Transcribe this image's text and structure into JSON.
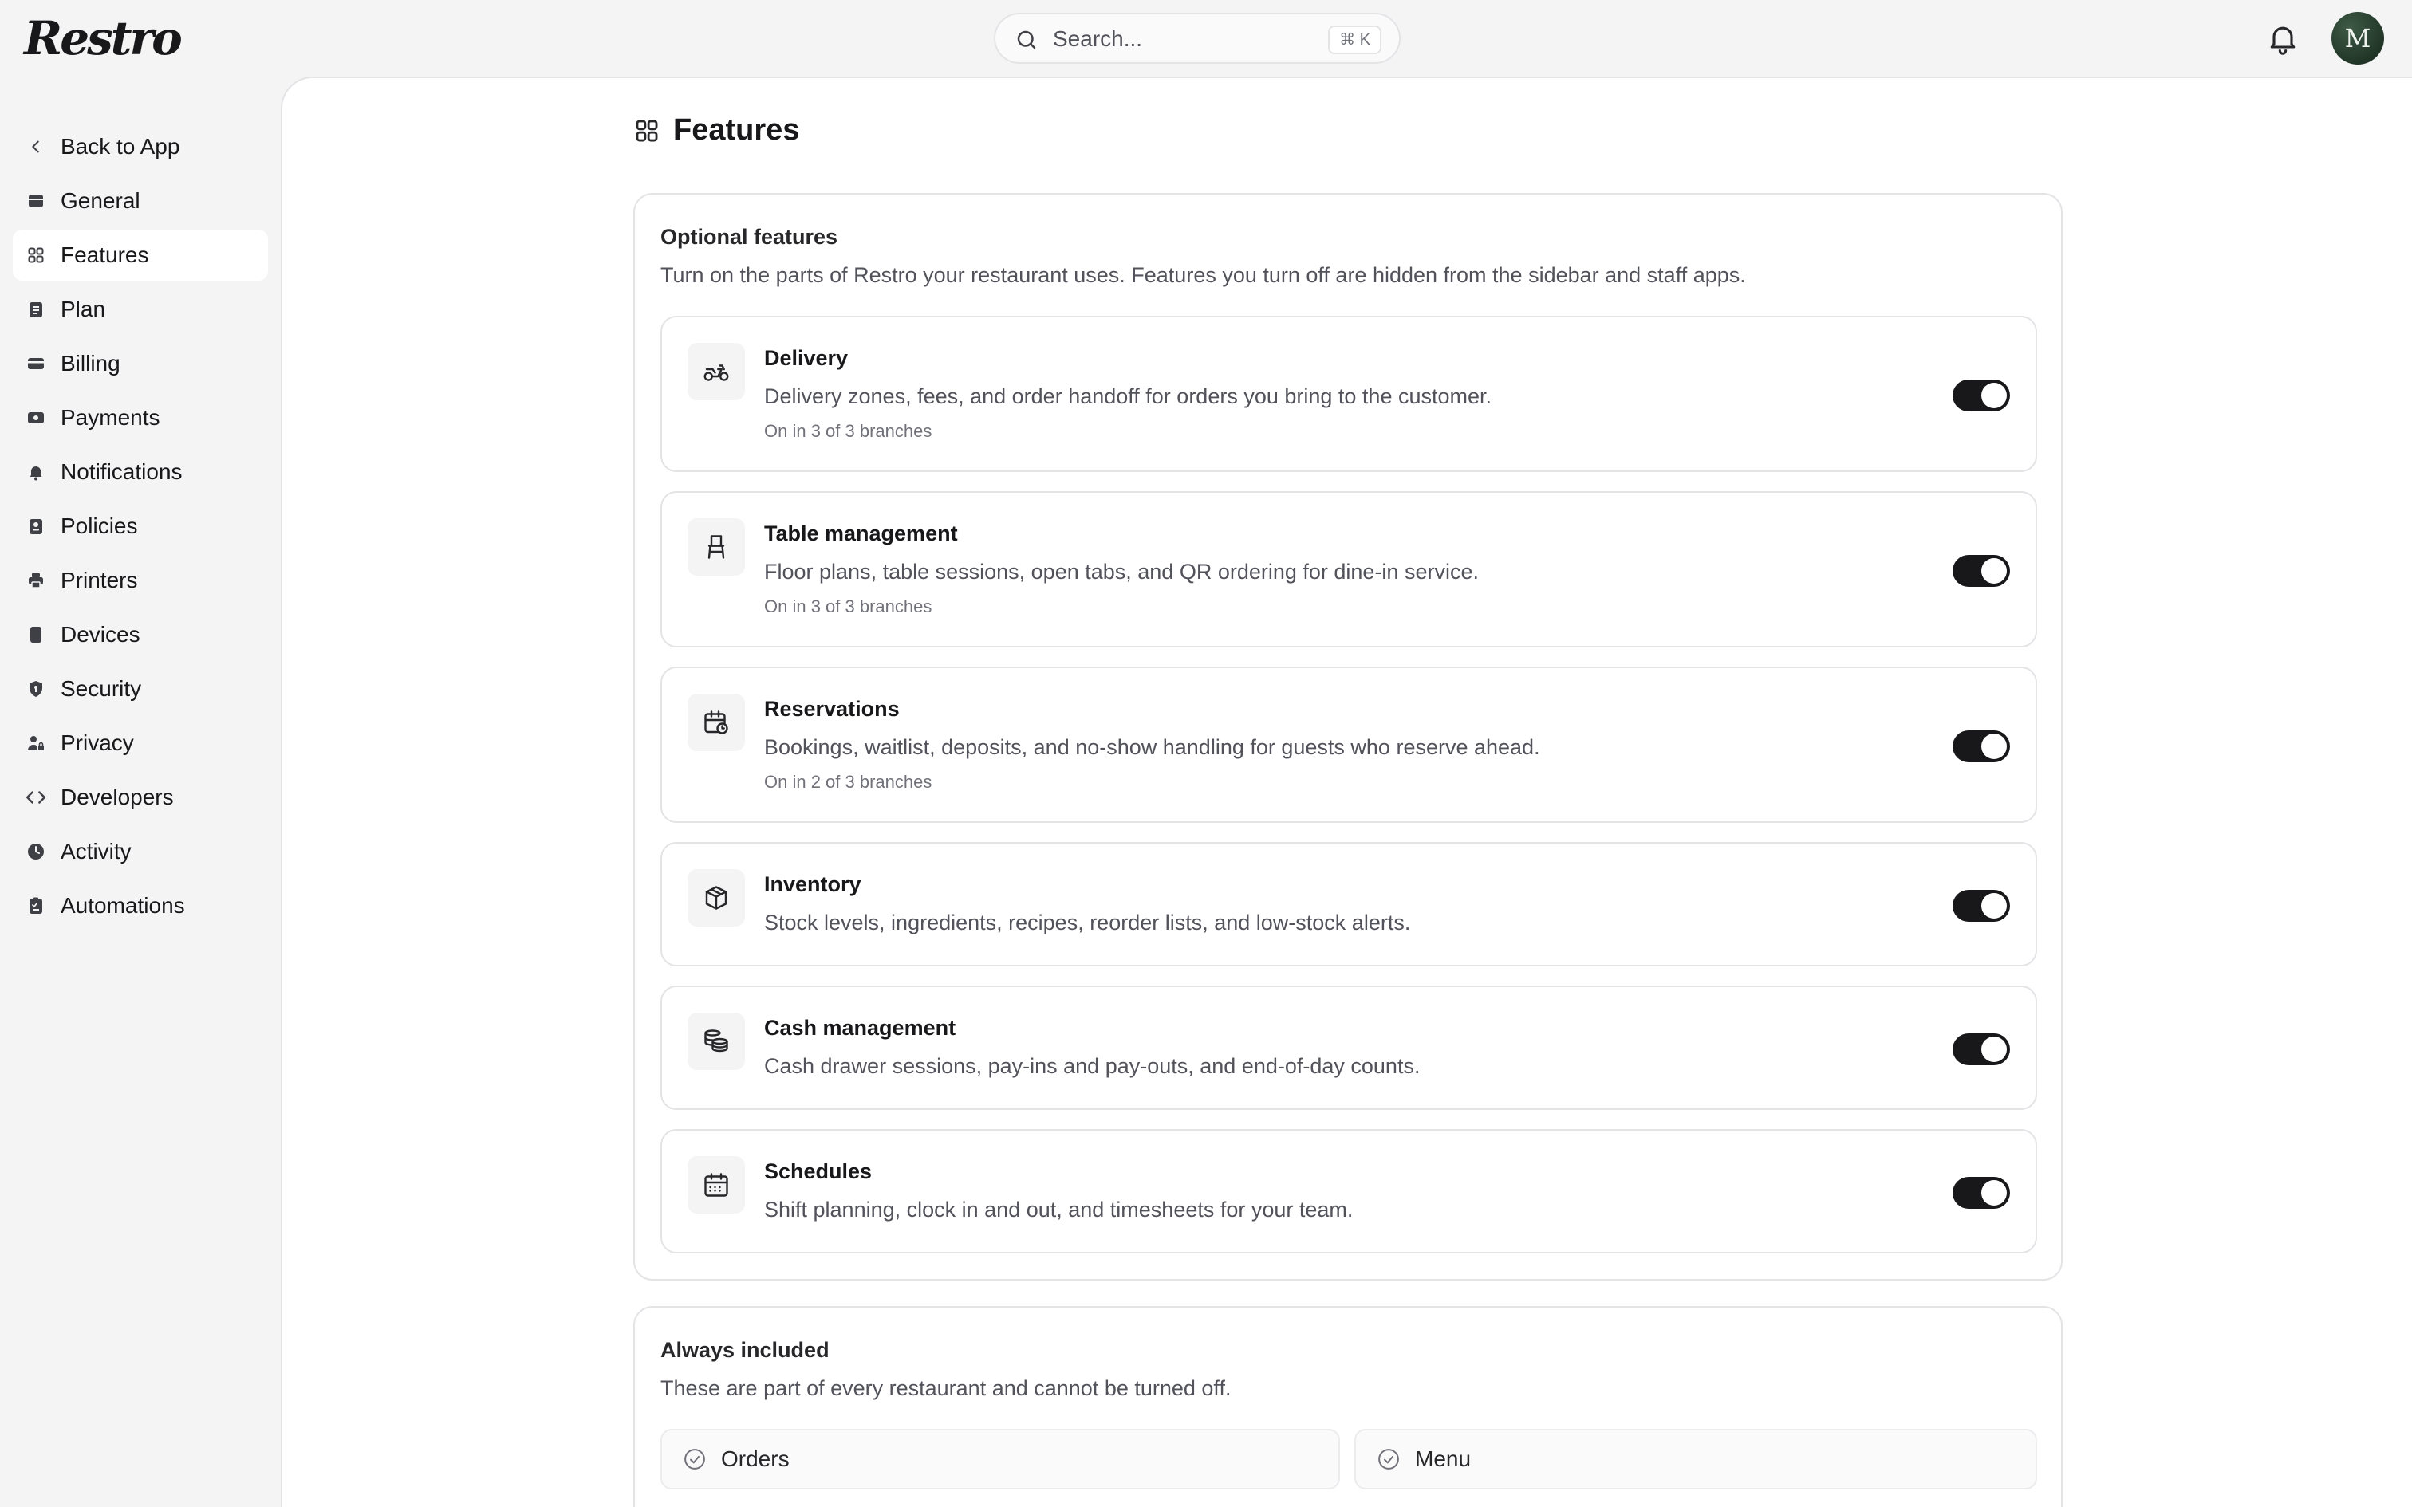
{
  "app": {
    "logo_text": "Restro"
  },
  "header": {
    "search_placeholder": "Search...",
    "search_shortcut": "⌘ K",
    "avatar_initial": "M"
  },
  "sidebar": {
    "back_label": "Back to App",
    "items": [
      {
        "label": "General",
        "icon": "store-icon",
        "active": false
      },
      {
        "label": "Features",
        "icon": "grid-icon",
        "active": true
      },
      {
        "label": "Plan",
        "icon": "clipboard-icon",
        "active": false
      },
      {
        "label": "Billing",
        "icon": "credit-card-icon",
        "active": false
      },
      {
        "label": "Payments",
        "icon": "wallet-icon",
        "active": false
      },
      {
        "label": "Notifications",
        "icon": "bell-icon",
        "active": false
      },
      {
        "label": "Policies",
        "icon": "policy-icon",
        "active": false
      },
      {
        "label": "Printers",
        "icon": "printer-icon",
        "active": false
      },
      {
        "label": "Devices",
        "icon": "tablet-icon",
        "active": false
      },
      {
        "label": "Security",
        "icon": "shield-icon",
        "active": false
      },
      {
        "label": "Privacy",
        "icon": "user-lock-icon",
        "active": false
      },
      {
        "label": "Developers",
        "icon": "code-icon",
        "active": false
      },
      {
        "label": "Activity",
        "icon": "clock-icon",
        "active": false
      },
      {
        "label": "Automations",
        "icon": "clipboard-list-icon",
        "active": false
      }
    ]
  },
  "page": {
    "title": "Features"
  },
  "optional": {
    "title": "Optional features",
    "description": "Turn on the parts of Restro your restaurant uses. Features you turn off are hidden from the sidebar and staff apps.",
    "features": [
      {
        "name": "Delivery",
        "description": "Delivery zones, fees, and order handoff for orders you bring to the customer.",
        "status": "On in 3 of 3 branches",
        "icon": "motorcycle-icon",
        "enabled": true
      },
      {
        "name": "Table management",
        "description": "Floor plans, table sessions, open tabs, and QR ordering for dine-in service.",
        "status": "On in 3 of 3 branches",
        "icon": "chair-icon",
        "enabled": true
      },
      {
        "name": "Reservations",
        "description": "Bookings, waitlist, deposits, and no-show handling for guests who reserve ahead.",
        "status": "On in 2 of 3 branches",
        "icon": "calendar-clock-icon",
        "enabled": true
      },
      {
        "name": "Inventory",
        "description": "Stock levels, ingredients, recipes, reorder lists, and low-stock alerts.",
        "status": "",
        "icon": "box-icon",
        "enabled": true
      },
      {
        "name": "Cash management",
        "description": "Cash drawer sessions, pay-ins and pay-outs, and end-of-day counts.",
        "status": "",
        "icon": "coins-icon",
        "enabled": true
      },
      {
        "name": "Schedules",
        "description": "Shift planning, clock in and out, and timesheets for your team.",
        "status": "",
        "icon": "calendar-icon",
        "enabled": true
      }
    ]
  },
  "always": {
    "title": "Always included",
    "description": "These are part of every restaurant and cannot be turned off.",
    "items": [
      {
        "label": "Orders",
        "icon": "check-circle-icon"
      },
      {
        "label": "Menu",
        "icon": "check-circle-icon"
      }
    ]
  }
}
